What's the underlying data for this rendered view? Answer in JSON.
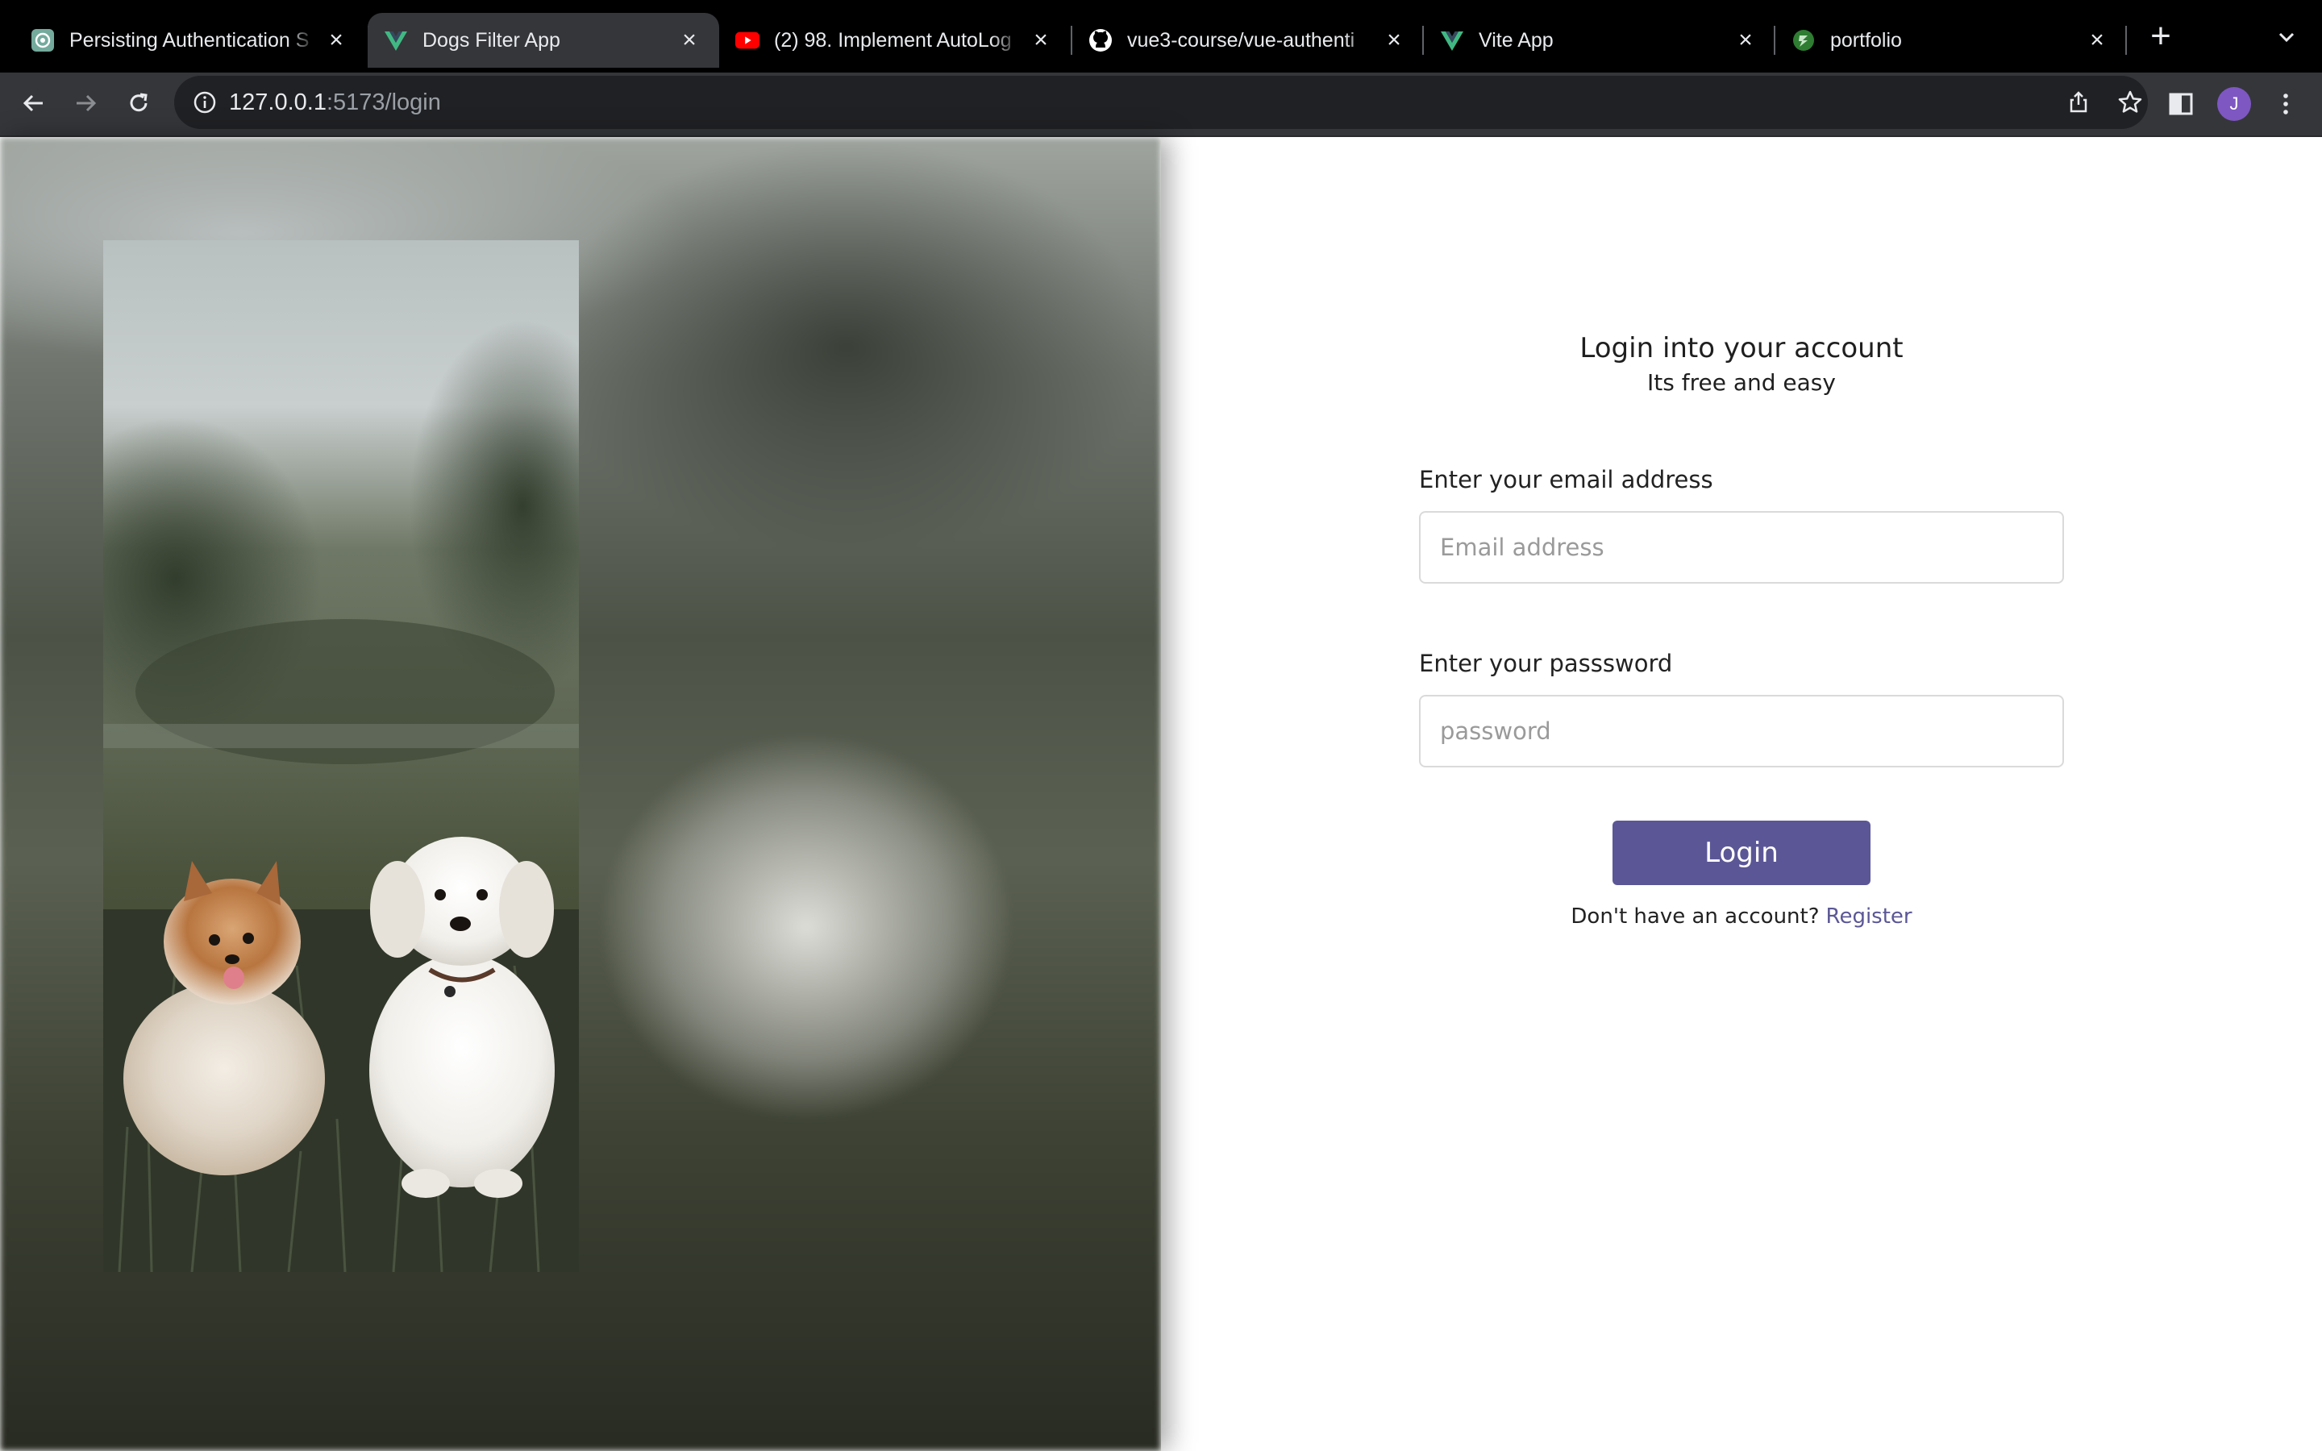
{
  "browser": {
    "tabs": [
      {
        "title": "Persisting Authentication S",
        "icon": "chatgpt-icon",
        "active": false
      },
      {
        "title": "Dogs Filter App",
        "icon": "vue-icon",
        "active": true
      },
      {
        "title": "(2) 98. Implement AutoLog",
        "icon": "youtube-icon",
        "active": false
      },
      {
        "title": "vue3-course/vue-authenti",
        "icon": "github-icon",
        "active": false
      },
      {
        "title": "Vite App",
        "icon": "vue-icon",
        "active": false
      },
      {
        "title": "portfolio",
        "icon": "vite-icon",
        "active": false
      }
    ],
    "new_tab_symbol": "+",
    "url_host": "127.0.0.1",
    "url_rest": ":5173/login",
    "profile_initial": "J",
    "colors": {
      "tabbar": "#000000",
      "toolbar": "#35363a",
      "omnibox": "#202124"
    }
  },
  "page": {
    "heading": "Login into your account",
    "subheading": "Its free and easy",
    "email_label": "Enter your email address",
    "email_placeholder": "Email address",
    "password_label": "Enter your passsword",
    "password_placeholder": "password",
    "login_button": "Login",
    "register_prompt": "Don't have an account?",
    "register_link": "Register",
    "colors": {
      "accent": "#5b5796"
    }
  }
}
